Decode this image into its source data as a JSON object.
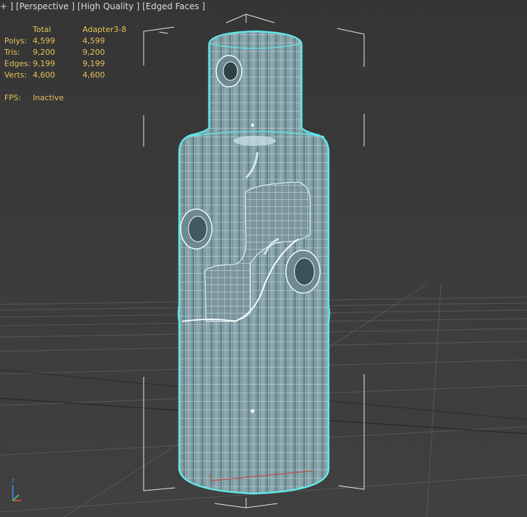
{
  "viewport": {
    "label_parts": [
      "+",
      "Perspective",
      "High Quality",
      "Edged Faces"
    ]
  },
  "stats": {
    "header_total": "Total",
    "header_object": "Adapter3-8",
    "rows": [
      {
        "label": "Polys:",
        "total": "4,599",
        "object": "4,599"
      },
      {
        "label": "Tris:",
        "total": "9,200",
        "object": "9,200"
      },
      {
        "label": "Edges:",
        "total": "9,199",
        "object": "9,199"
      },
      {
        "label": "Verts:",
        "total": "4,600",
        "object": "4,600"
      }
    ],
    "fps_label": "FPS:",
    "fps_value": "Inactive"
  },
  "colors": {
    "wire": "#63e6ea",
    "mesh_fill": "#8fb0b7",
    "stats_text": "#e6c25a",
    "grid": "#5a5a5a"
  },
  "axis": {
    "x_label": "x"
  }
}
